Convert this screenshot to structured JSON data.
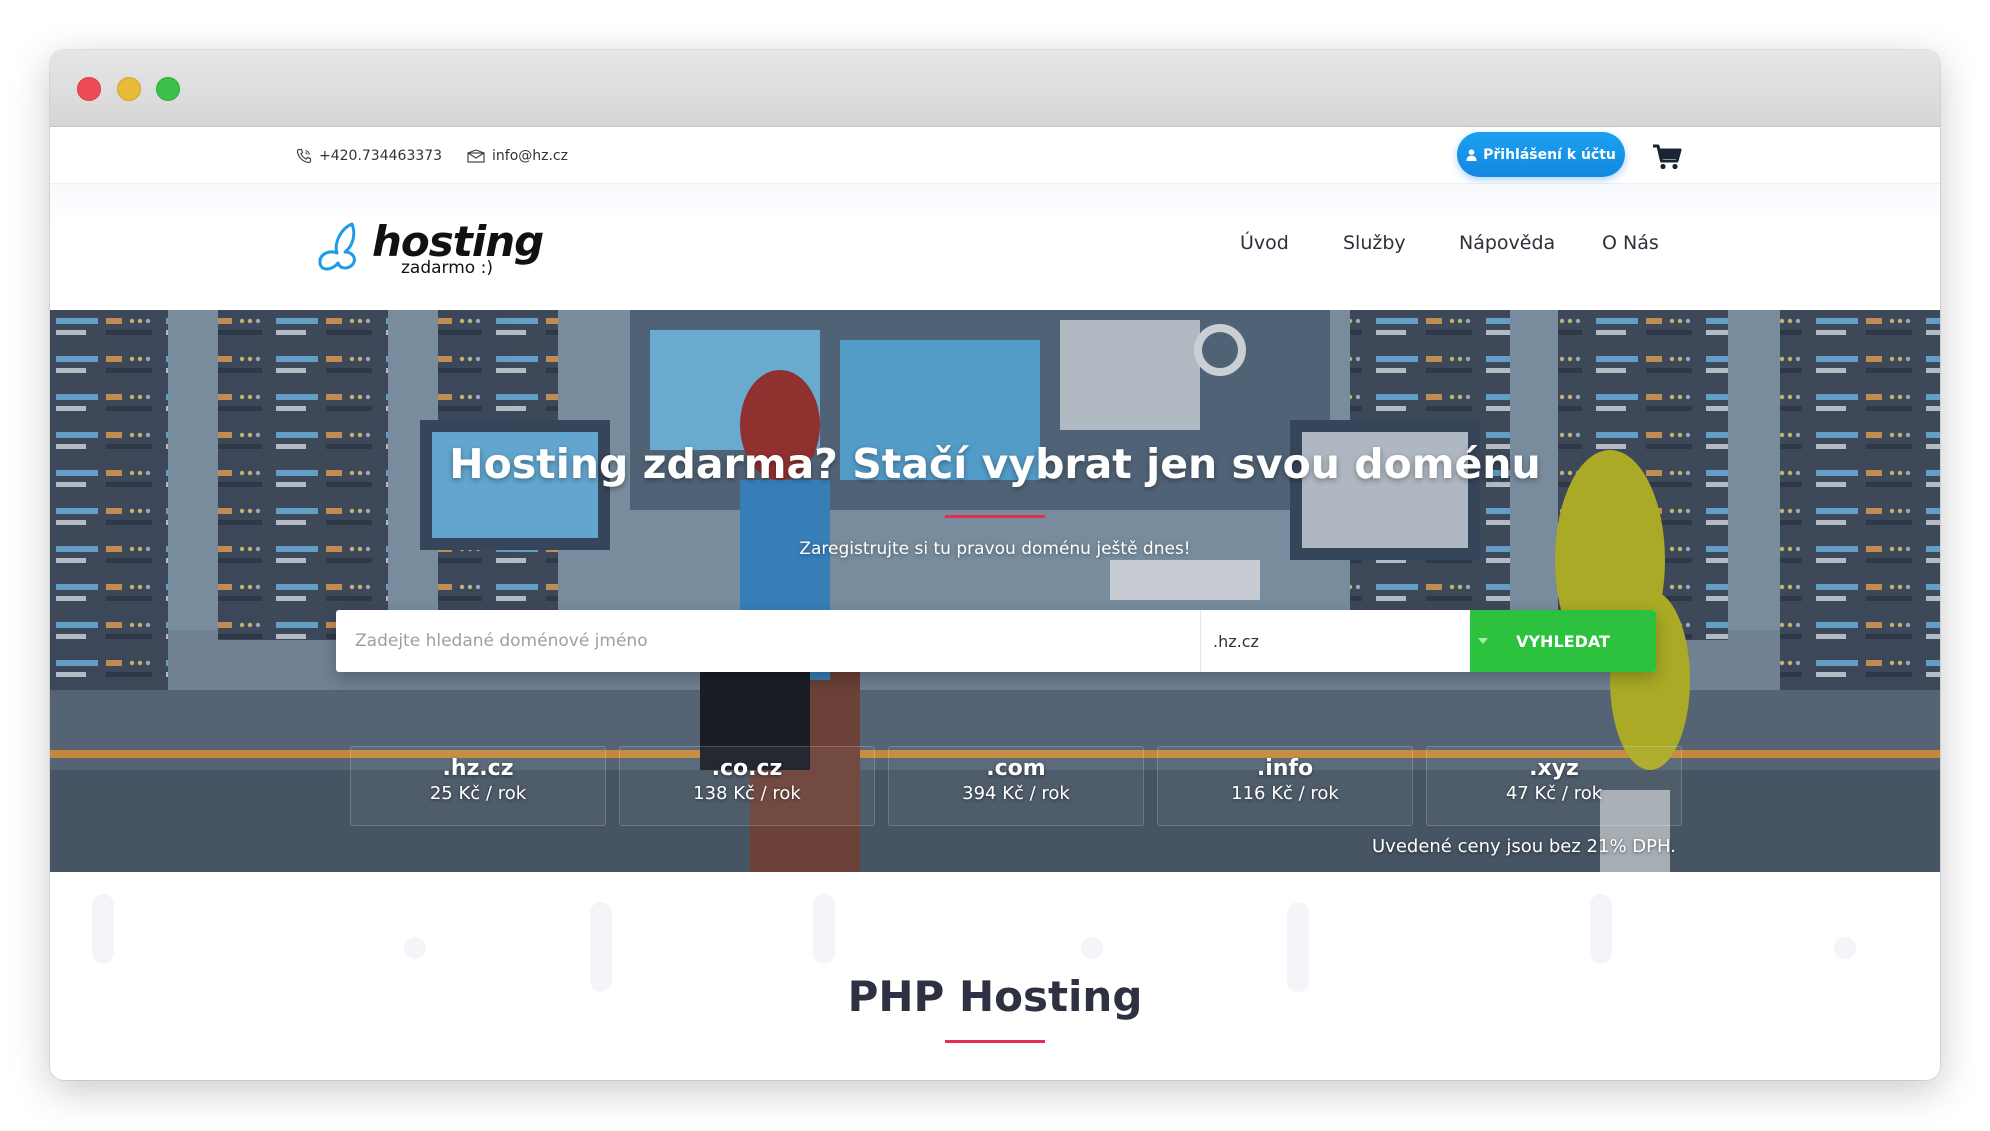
{
  "topbar": {
    "phone": "+420.734463373",
    "email": "info@hz.cz",
    "login_label": "Přihlášení k účtu"
  },
  "logo": {
    "word": "hosting",
    "sub": "zadarmo :)"
  },
  "nav": [
    "Úvod",
    "Služby",
    "Nápověda",
    "O Nás"
  ],
  "hero": {
    "title": "Hosting zdarma? Stačí vybrat jen svou doménu",
    "subtitle": "Zaregistrujte si tu pravou doménu ještě dnes!",
    "search_placeholder": "Zadejte hledané doménové jméno",
    "selected_tld": ".hz.cz",
    "search_button": "VYHLEDAT",
    "prices": [
      {
        "tld": ".hz.cz",
        "price": "25 Kč / rok"
      },
      {
        "tld": ".co.cz",
        "price": "138 Kč / rok"
      },
      {
        "tld": ".com",
        "price": "394 Kč / rok"
      },
      {
        "tld": ".info",
        "price": "116 Kč / rok"
      },
      {
        "tld": ".xyz",
        "price": "47 Kč / rok"
      }
    ],
    "vat_note": "Uvedené ceny jsou bez 21% DPH."
  },
  "section": {
    "title": "PHP Hosting"
  },
  "colors": {
    "accent_blue": "#1da1f2",
    "search_green": "#2dc23d",
    "underline_red": "#e52d55",
    "title_dark": "#2d3142"
  },
  "icons": [
    "phone-icon",
    "envelope-icon",
    "user-icon",
    "cart-icon",
    "butterfly-logo-icon",
    "chevron-down-icon"
  ]
}
